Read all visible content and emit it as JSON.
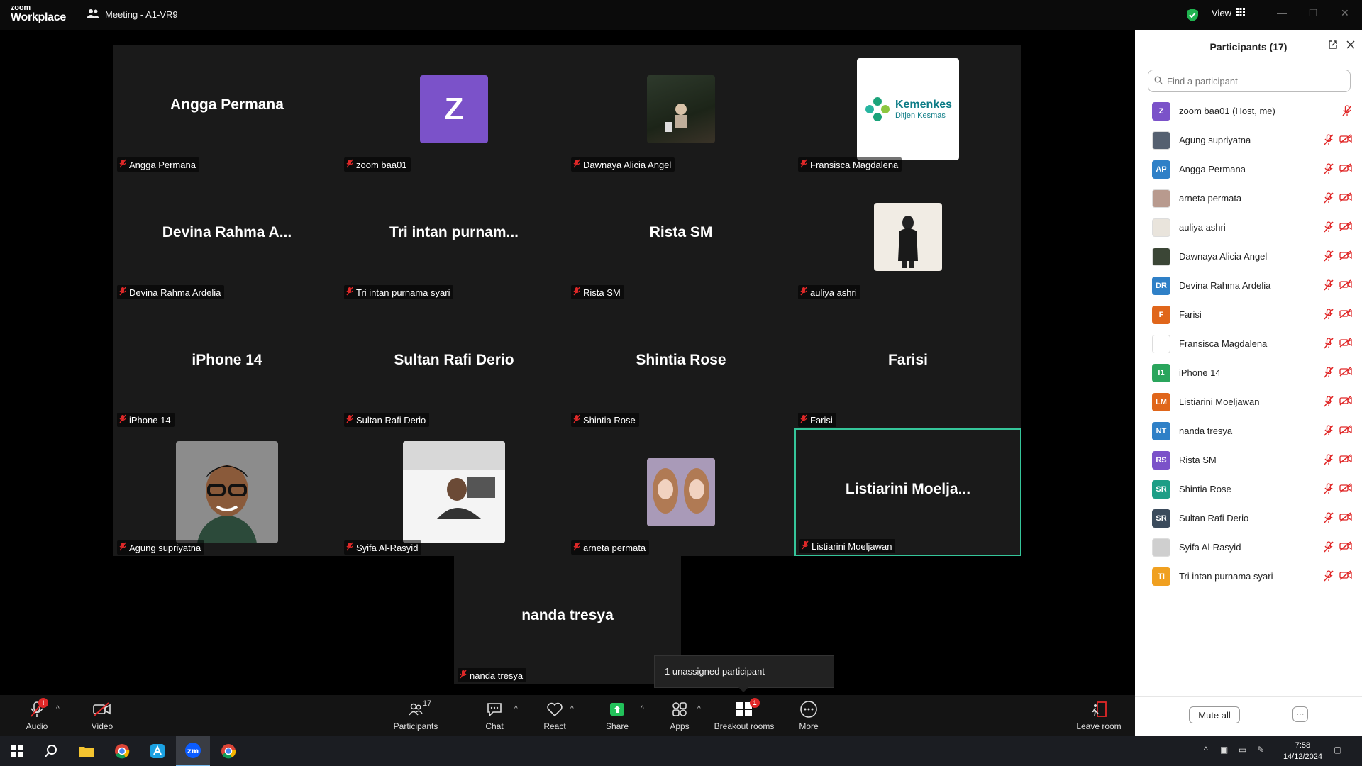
{
  "titlebar": {
    "logo_top": "zoom",
    "logo_bottom": "Workplace",
    "meeting_title": "Meeting - A1-VR9",
    "view_label": "View"
  },
  "tiles": [
    {
      "big": "Angga Permana",
      "tag": "Angga Permana",
      "avatar": null
    },
    {
      "big": "",
      "tag": "zoom baa01",
      "avatar": "letter-z"
    },
    {
      "big": "",
      "tag": "Dawnaya Alicia Angel",
      "avatar": "photo-dark-room"
    },
    {
      "big": "",
      "tag": "Fransisca Magdalena",
      "avatar": "kemenkes-logo"
    },
    {
      "big": "Devina Rahma A...",
      "tag": "Devina Rahma Ardelia",
      "avatar": null
    },
    {
      "big": "Tri intan purnam...",
      "tag": "Tri intan purnama syari",
      "avatar": null
    },
    {
      "big": "Rista SM",
      "tag": "Rista SM",
      "avatar": null
    },
    {
      "big": "",
      "tag": "auliya ashri",
      "avatar": "photo-hijab"
    },
    {
      "big": "iPhone 14",
      "tag": "iPhone 14",
      "avatar": null
    },
    {
      "big": "Sultan Rafi Derio",
      "tag": "Sultan Rafi Derio",
      "avatar": null
    },
    {
      "big": "Shintia Rose",
      "tag": "Shintia Rose",
      "avatar": null
    },
    {
      "big": "Farisi",
      "tag": "Farisi",
      "avatar": null
    },
    {
      "big": "",
      "tag": "Agung supriyatna",
      "avatar": "photo-glasses-man"
    },
    {
      "big": "",
      "tag": "Syifa Al-Rasyid",
      "avatar": "photo-car"
    },
    {
      "big": "",
      "tag": "arneta permata",
      "avatar": "photo-two-girls"
    },
    {
      "big": "Listiarini  Moelja...",
      "tag": "Listiarini Moeljawan",
      "avatar": null
    },
    {
      "big": "nanda tresya",
      "tag": "nanda tresya",
      "avatar": null
    }
  ],
  "kemenkes": {
    "line1": "Kemenkes",
    "line2": "Ditjen Kesmas"
  },
  "avatar_letter_z": "Z",
  "unassigned_text": "1 unassigned participant",
  "toolbar": {
    "audio": "Audio",
    "video": "Video",
    "participants": "Participants",
    "participants_count": "17",
    "chat": "Chat",
    "react": "React",
    "share": "Share",
    "apps": "Apps",
    "breakout": "Breakout rooms",
    "breakout_badge": "1",
    "more": "More",
    "leave": "Leave room"
  },
  "panel": {
    "title": "Participants (17)",
    "search_placeholder": "Find a participant",
    "mute_all": "Mute all",
    "more": "···",
    "participants": [
      {
        "initials": "Z",
        "name": "zoom baa01 (Host, me)",
        "color": "#7b52c9",
        "photo": false,
        "video_icon": false
      },
      {
        "initials": "",
        "name": "Agung supriyatna",
        "color": "#556070",
        "photo": true,
        "video_icon": true
      },
      {
        "initials": "AP",
        "name": "Angga Permana",
        "color": "#2f80c7",
        "photo": false,
        "video_icon": true
      },
      {
        "initials": "",
        "name": "arneta permata",
        "color": "#b89a8e",
        "photo": true,
        "video_icon": true
      },
      {
        "initials": "",
        "name": "auliya ashri",
        "color": "#e9e4dc",
        "photo": true,
        "video_icon": true
      },
      {
        "initials": "",
        "name": "Dawnaya Alicia Angel",
        "color": "#3b4636",
        "photo": true,
        "video_icon": true
      },
      {
        "initials": "DR",
        "name": "Devina Rahma Ardelia",
        "color": "#2f80c7",
        "photo": false,
        "video_icon": true
      },
      {
        "initials": "F",
        "name": "Farisi",
        "color": "#e0661b",
        "photo": false,
        "video_icon": true
      },
      {
        "initials": "",
        "name": "Fransisca Magdalena",
        "color": "#ffffff",
        "photo": true,
        "video_icon": true
      },
      {
        "initials": "I1",
        "name": "iPhone 14",
        "color": "#2aa55c",
        "photo": false,
        "video_icon": true
      },
      {
        "initials": "LM",
        "name": "Listiarini Moeljawan",
        "color": "#e0661b",
        "photo": false,
        "video_icon": true
      },
      {
        "initials": "NT",
        "name": "nanda tresya",
        "color": "#2f80c7",
        "photo": false,
        "video_icon": true
      },
      {
        "initials": "RS",
        "name": "Rista SM",
        "color": "#7b52c9",
        "photo": false,
        "video_icon": true
      },
      {
        "initials": "SR",
        "name": "Shintia Rose",
        "color": "#1d9e86",
        "photo": false,
        "video_icon": true
      },
      {
        "initials": "SR",
        "name": "Sultan Rafi Derio",
        "color": "#3b4b5c",
        "photo": false,
        "video_icon": true
      },
      {
        "initials": "",
        "name": "Syifa Al-Rasyid",
        "color": "#cfcfcf",
        "photo": true,
        "video_icon": true
      },
      {
        "initials": "TI",
        "name": "Tri intan purnama syari",
        "color": "#f0a020",
        "photo": false,
        "video_icon": true
      }
    ]
  },
  "taskbar": {
    "time": "7:58",
    "date": "14/12/2024"
  },
  "colors": {
    "accent_green": "#35c59a",
    "mute_red": "#e02828",
    "zoom_blue": "#0b5cff"
  }
}
